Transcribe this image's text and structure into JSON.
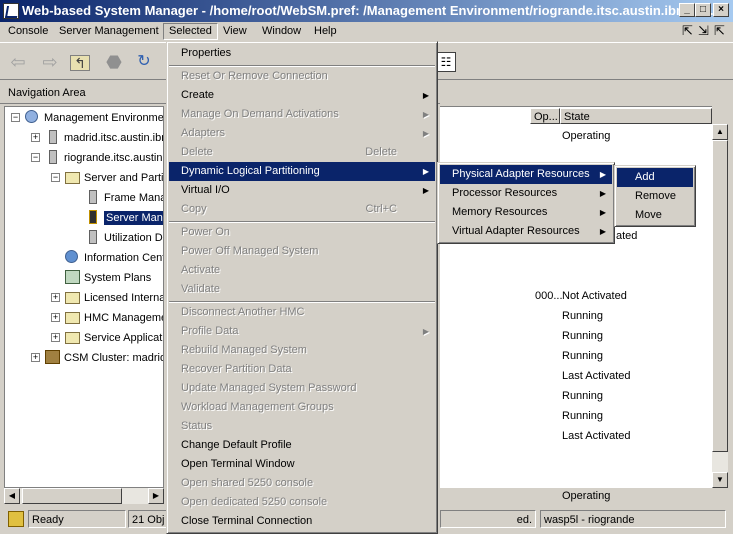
{
  "window": {
    "title": "Web-based System Manager - /home/root/WebSM.pref: /Management Environment/riogrande.itsc.austin.ibm.co...",
    "minimize": "_",
    "maximize": "□",
    "close": "×"
  },
  "menubar": {
    "items": [
      "Console",
      "Server Management",
      "Selected",
      "View",
      "Window",
      "Help"
    ]
  },
  "nav": {
    "header": "Navigation Area"
  },
  "tree": {
    "items": [
      {
        "label": "Management Environment",
        "icon": "globe-icon"
      },
      {
        "label": "madrid.itsc.austin.ibm",
        "icon": "server-icon"
      },
      {
        "label": "riogrande.itsc.austin",
        "icon": "server-icon"
      },
      {
        "label": "Server and Parti",
        "icon": "folder-icon"
      },
      {
        "label": "Frame Mana",
        "icon": "server-icon"
      },
      {
        "label": "Server Mana",
        "icon": "server-icon"
      },
      {
        "label": "Utilization Da",
        "icon": "server-icon"
      },
      {
        "label": "Information Cent",
        "icon": "info-center-icon"
      },
      {
        "label": "System Plans",
        "icon": "system-plans-icon"
      },
      {
        "label": "Licensed Interna",
        "icon": "folder-icon"
      },
      {
        "label": "HMC Manageme",
        "icon": "folder-icon"
      },
      {
        "label": "Service Applicat",
        "icon": "folder-icon"
      },
      {
        "label": "CSM Cluster: madrid",
        "icon": "cluster-icon"
      }
    ]
  },
  "table": {
    "columns": [
      "Op...",
      "State"
    ],
    "rows": [
      {
        "op": "",
        "state": "Operating"
      },
      {
        "op": "",
        "state": "ated"
      },
      {
        "op": "000...",
        "state": "Not Activated"
      },
      {
        "op": "",
        "state": "Running"
      },
      {
        "op": "",
        "state": "Running"
      },
      {
        "op": "",
        "state": "Running"
      },
      {
        "op": "",
        "state": "Last Activated"
      },
      {
        "op": "",
        "state": "Running"
      },
      {
        "op": "",
        "state": "Running"
      },
      {
        "op": "",
        "state": "Last Activated"
      },
      {
        "op": "",
        "state": "Operating"
      }
    ]
  },
  "selected_menu": {
    "items": [
      {
        "label": "Properties",
        "enabled": true
      },
      {
        "label": "Reset Or Remove Connection",
        "enabled": false
      },
      {
        "label": "Create",
        "enabled": true,
        "submenu": true
      },
      {
        "label": "Manage On Demand Activations",
        "enabled": false,
        "submenu": true
      },
      {
        "label": "Adapters",
        "enabled": false,
        "submenu": true
      },
      {
        "label": "Delete",
        "enabled": false,
        "shortcut": "Delete"
      },
      {
        "label": "Dynamic Logical Partitioning",
        "enabled": true,
        "submenu": true,
        "highlighted": true
      },
      {
        "label": "Virtual I/O",
        "enabled": true,
        "submenu": true
      },
      {
        "label": "Copy",
        "enabled": false,
        "shortcut": "Ctrl+C"
      },
      {
        "label": "Power On",
        "enabled": false
      },
      {
        "label": "Power Off Managed System",
        "enabled": false
      },
      {
        "label": "Activate",
        "enabled": false
      },
      {
        "label": "Validate",
        "enabled": false
      },
      {
        "label": "Disconnect Another HMC",
        "enabled": false
      },
      {
        "label": "Profile Data",
        "enabled": false,
        "submenu": true
      },
      {
        "label": "Rebuild Managed System",
        "enabled": false
      },
      {
        "label": "Recover Partition Data",
        "enabled": false
      },
      {
        "label": "Update Managed System Password",
        "enabled": false
      },
      {
        "label": "Workload Management Groups",
        "enabled": false
      },
      {
        "label": "Status",
        "enabled": false
      },
      {
        "label": "Change Default Profile",
        "enabled": true
      },
      {
        "label": "Open Terminal Window",
        "enabled": true
      },
      {
        "label": "Open shared 5250 console",
        "enabled": false
      },
      {
        "label": "Open dedicated 5250 console",
        "enabled": false
      },
      {
        "label": "Close Terminal Connection",
        "enabled": true
      }
    ]
  },
  "dlpar_menu": {
    "items": [
      {
        "label": "Physical Adapter Resources",
        "highlighted": true
      },
      {
        "label": "Processor Resources"
      },
      {
        "label": "Memory Resources"
      },
      {
        "label": "Virtual Adapter Resources"
      }
    ]
  },
  "physical_menu": {
    "items": [
      "Add",
      "Remove",
      "Move"
    ]
  },
  "status": {
    "ready": "Ready",
    "objects": "21 Obj",
    "loaded": "ed.",
    "host": "wasp5l - riogrande"
  },
  "colors": {
    "selection": "#0a246a",
    "chrome": "#d4d0c8"
  }
}
